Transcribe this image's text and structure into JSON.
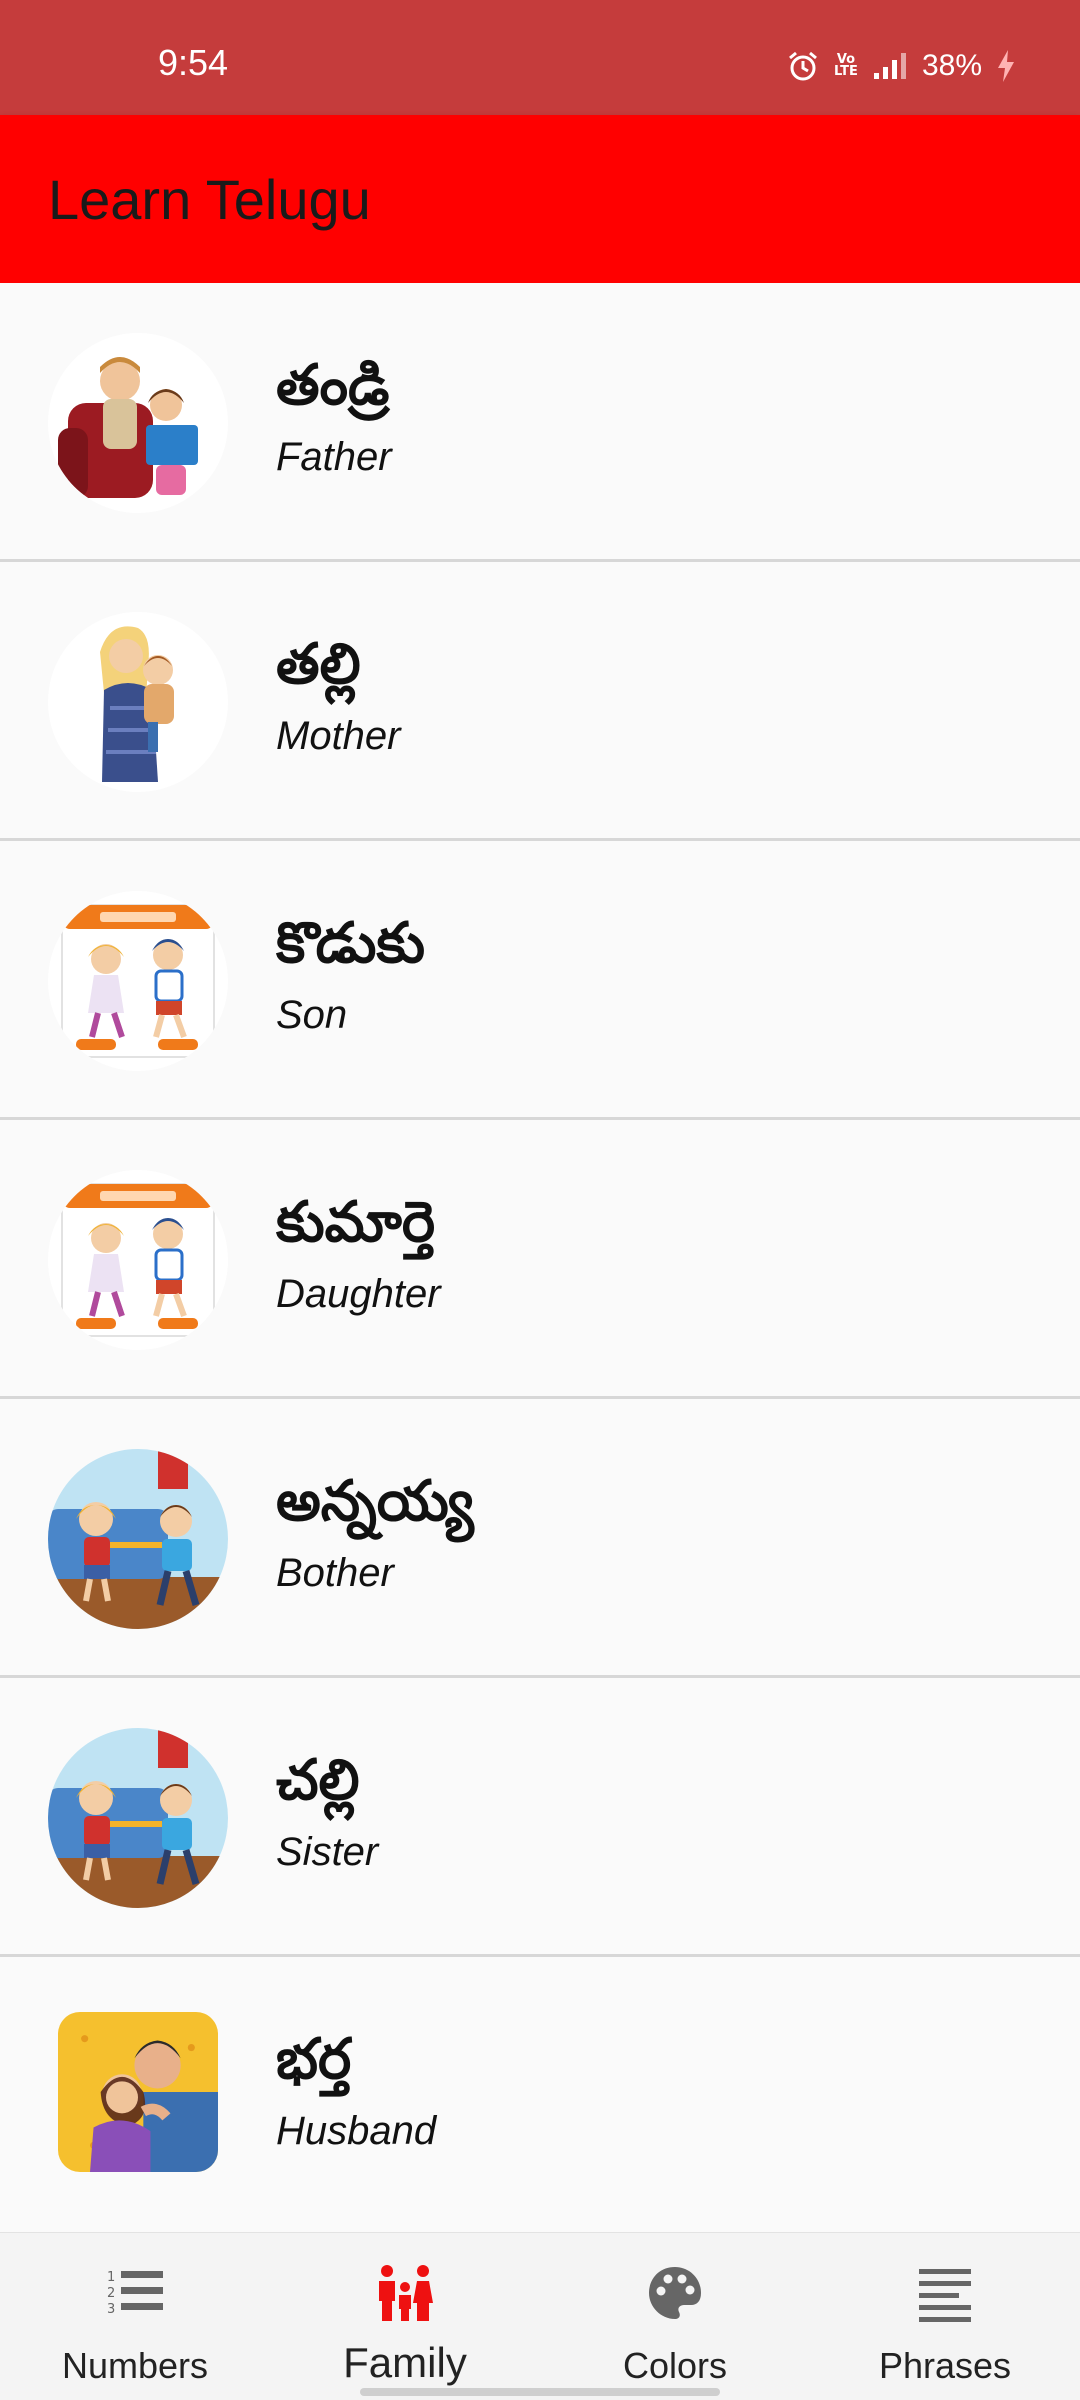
{
  "status_bar": {
    "time": "9:54",
    "battery": "38%",
    "volte": "Vo LTE"
  },
  "app_bar": {
    "title": "Learn Telugu"
  },
  "entries": [
    {
      "telugu": "తండ్రి",
      "english": "Father",
      "image": "father-reading-with-child-image"
    },
    {
      "telugu": "తల్లి",
      "english": "Mother",
      "image": "mother-holding-child-image"
    },
    {
      "telugu": "కొడుకు",
      "english": "Son",
      "image": "opposites-daughter-son-card-image"
    },
    {
      "telugu": "కుమార్తె",
      "english": "Daughter",
      "image": "opposites-daughter-son-card-image"
    },
    {
      "telugu": "అన్నయ్య",
      "english": "Bother",
      "image": "siblings-playing-image"
    },
    {
      "telugu": "చల్లి",
      "english": "Sister",
      "image": "siblings-playing-image"
    },
    {
      "telugu": "భర్త",
      "english": "Husband",
      "image": "husband-and-wife-image"
    }
  ],
  "bottom_nav": {
    "items": [
      {
        "label": "Numbers",
        "icon": "numbered-list-icon"
      },
      {
        "label": "Family",
        "icon": "family-icon"
      },
      {
        "label": "Colors",
        "icon": "palette-icon"
      },
      {
        "label": "Phrases",
        "icon": "lines-icon"
      }
    ],
    "active": "Family"
  },
  "colors": {
    "status_bar": "#c53c3c",
    "app_bar": "#ff0000",
    "active_nav": "#ee1111"
  }
}
